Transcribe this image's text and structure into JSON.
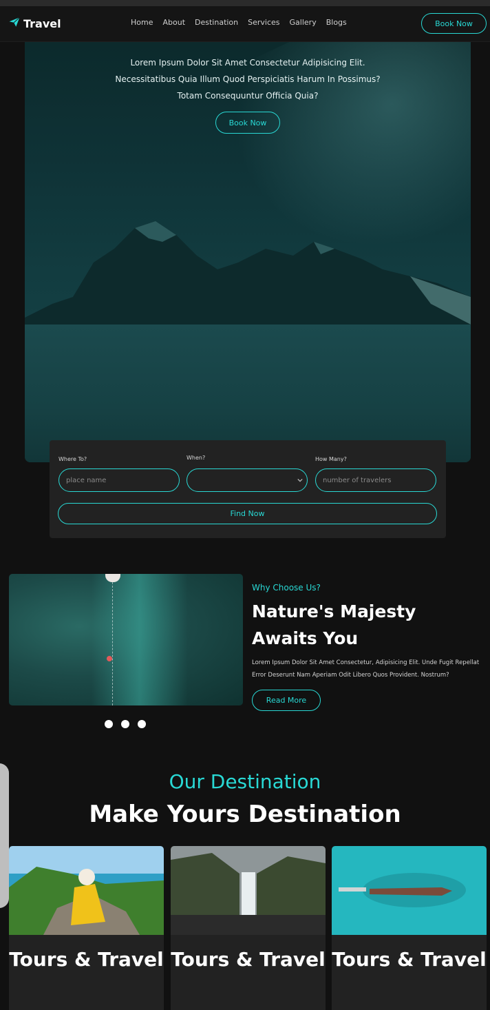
{
  "brand": {
    "name": "Travel",
    "icon": "paper-plane-icon",
    "accent": "#29d9d5"
  },
  "nav": {
    "links": [
      "Home",
      "About",
      "Destination",
      "Services",
      "Gallery",
      "Blogs"
    ],
    "cta": "Book Now"
  },
  "hero": {
    "lines": [
      "Lorem Ipsum Dolor Sit Amet Consectetur Adipisicing Elit.",
      "Necessitatibus Quia Illum Quod Perspiciatis Harum In Possimus?",
      "Totam Consequuntur Officia Quia?"
    ],
    "button": "Book Now"
  },
  "search": {
    "where_label": "Where To?",
    "where_placeholder": "place name",
    "when_label": "When?",
    "when_value": "",
    "howmany_label": "How Many?",
    "howmany_placeholder": "number of travelers",
    "button": "Find Now"
  },
  "why": {
    "subtitle": "Why Choose Us?",
    "title": "Nature's Majesty Awaits You",
    "text": "Lorem Ipsum Dolor Sit Amet Consectetur, Adipisicing Elit. Unde Fugit Repellat Error Deserunt Nam Aperiam Odit Libero Quos Provident. Nostrum?",
    "button": "Read More",
    "slider_dots": 3
  },
  "destination": {
    "subtitle": "Our Destination",
    "title": "Make Yours Destination",
    "cards": [
      {
        "title": "Tours & Travel"
      },
      {
        "title": "Tours & Travel"
      },
      {
        "title": "Tours & Travel"
      }
    ]
  }
}
